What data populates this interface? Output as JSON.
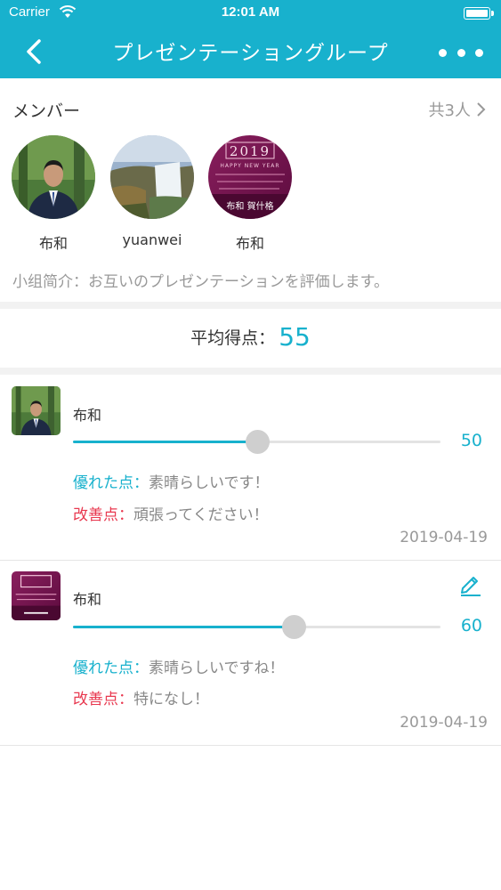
{
  "status_bar": {
    "carrier": "Carrier",
    "time": "12:01 AM"
  },
  "nav": {
    "title": "プレゼンテーショングループ"
  },
  "members_section": {
    "title": "メンバー",
    "count": "共3人",
    "members": [
      {
        "name": "布和",
        "avatar": "portrait-photo"
      },
      {
        "name": "yuanwei",
        "avatar": "waterfall-photo"
      },
      {
        "name": "布和",
        "avatar": "new-year-card",
        "card_year": "2019",
        "card_greeting": "HAPPY NEW YEAR",
        "card_sign": "布和 賀什格"
      }
    ],
    "intro": "小组简介：お互いのプレゼンテーションを評価します。"
  },
  "average": {
    "label": "平均得点：",
    "value": "55"
  },
  "reviews": [
    {
      "name": "布和",
      "score": "50",
      "score_fraction": 0.5,
      "good_label": "優れた点：",
      "good_text": "素晴らしいです！",
      "bad_label": "改善点：",
      "bad_text": "頑張ってください！",
      "date": "2019-04-19",
      "avatar": "portrait-photo"
    },
    {
      "name": "布和",
      "score": "60",
      "score_fraction": 0.6,
      "good_label": "優れた点：",
      "good_text": "素晴らしいですね！",
      "bad_label": "改善点：",
      "bad_text": "特になし！",
      "date": "2019-04-19",
      "avatar": "new-year-card",
      "editable": true
    }
  ],
  "colors": {
    "accent": "#18b1cd",
    "improve": "#e8384f",
    "muted": "#999999"
  }
}
